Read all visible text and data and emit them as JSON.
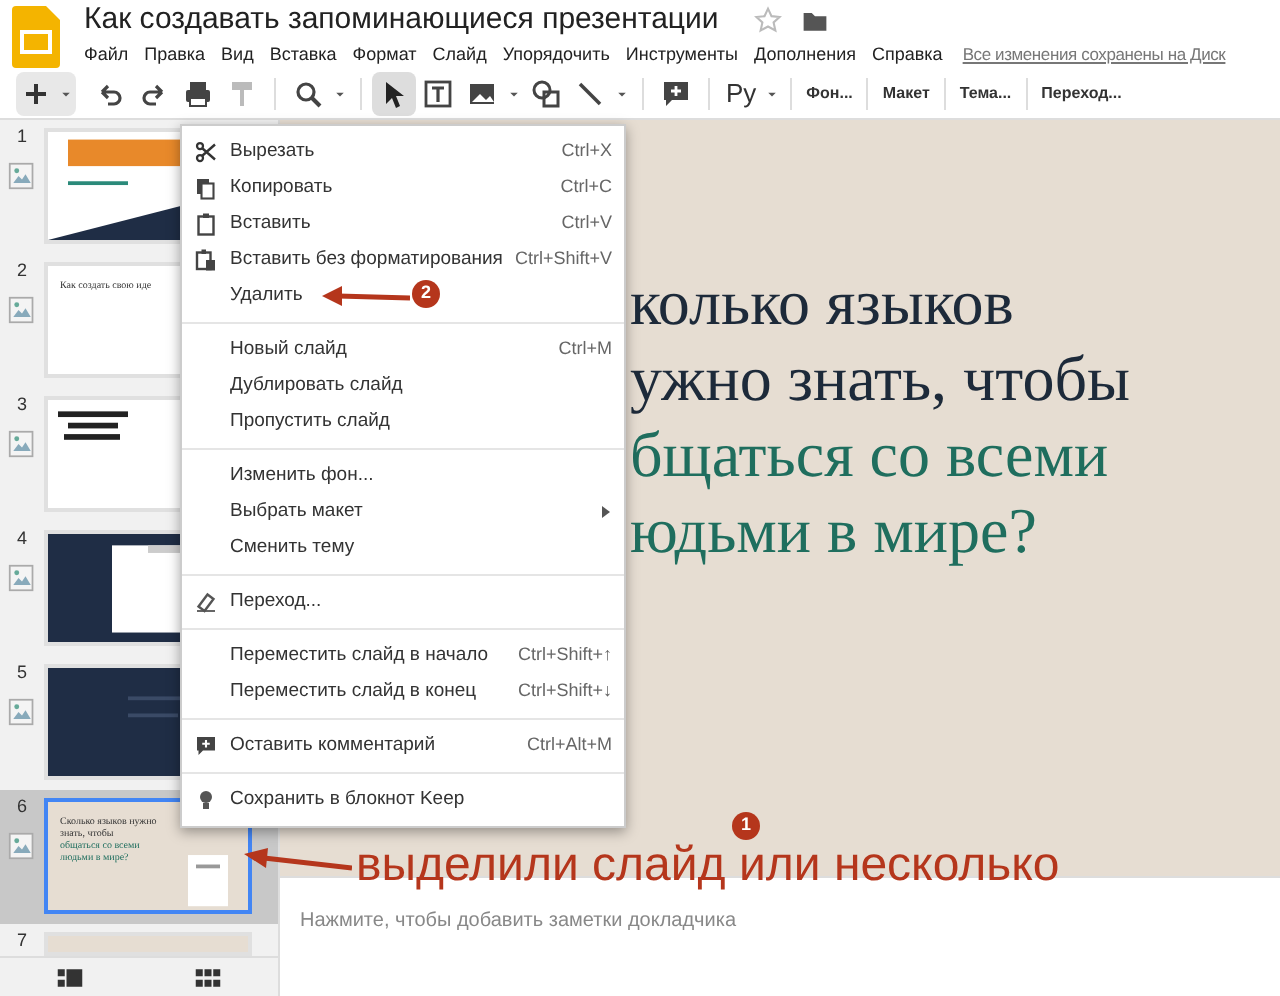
{
  "document": {
    "title": "Как создавать запоминающиеся презентации"
  },
  "menu_bar": [
    "Файл",
    "Правка",
    "Вид",
    "Вставка",
    "Формат",
    "Слайд",
    "Упорядочить",
    "Инструменты",
    "Дополнения",
    "Справка"
  ],
  "save_status": "Все изменения сохранены на Диск",
  "toolbar": {
    "input_tool": "Ру",
    "buttons": [
      "Фон...",
      "Макет",
      "Тема...",
      "Переход..."
    ]
  },
  "slides": [
    {
      "number": "1",
      "selected": false
    },
    {
      "number": "2",
      "selected": false,
      "text": "Как создать свою иде"
    },
    {
      "number": "3",
      "selected": false
    },
    {
      "number": "4",
      "selected": false
    },
    {
      "number": "5",
      "selected": false
    },
    {
      "number": "6",
      "selected": true,
      "text": "Сколько языков нужно знать, чтобы",
      "accent_text": "общаться со всеми людьми в мире?"
    },
    {
      "number": "7",
      "selected": false
    }
  ],
  "context_menu": [
    [
      {
        "label": "Вырезать",
        "shortcut": "Ctrl+X"
      },
      {
        "label": "Копировать",
        "shortcut": "Ctrl+C"
      },
      {
        "label": "Вставить",
        "shortcut": "Ctrl+V"
      },
      {
        "label": "Вставить без форматирования",
        "shortcut": "Ctrl+Shift+V"
      },
      {
        "label": "Удалить"
      }
    ],
    [
      {
        "label": "Новый слайд",
        "shortcut": "Ctrl+M"
      },
      {
        "label": "Дублировать слайд"
      },
      {
        "label": "Пропустить слайд"
      }
    ],
    [
      {
        "label": "Изменить фон..."
      },
      {
        "label": "Выбрать макет",
        "submenu": true
      },
      {
        "label": "Сменить тему"
      }
    ],
    [
      {
        "label": "Переход..."
      }
    ],
    [
      {
        "label": "Переместить слайд в начало",
        "shortcut": "Ctrl+Shift+↑"
      },
      {
        "label": "Переместить слайд в конец",
        "shortcut": "Ctrl+Shift+↓"
      }
    ],
    [
      {
        "label": "Оставить комментарий",
        "shortcut": "Ctrl+Alt+M"
      }
    ],
    [
      {
        "label": "Сохранить в блокнот Keep"
      }
    ]
  ],
  "slide_title": {
    "lines": [
      "колько языков",
      "ужно знать, чтобы"
    ],
    "accent_lines": [
      "бщаться со всеми",
      "юдьми в мире?"
    ]
  },
  "speaker_notes": {
    "placeholder": "Нажмите, чтобы добавить заметки докладчика"
  },
  "annotations": [
    {
      "badge": "1",
      "caption": "выделили слайд или несколько"
    },
    {
      "badge": "2"
    }
  ]
}
